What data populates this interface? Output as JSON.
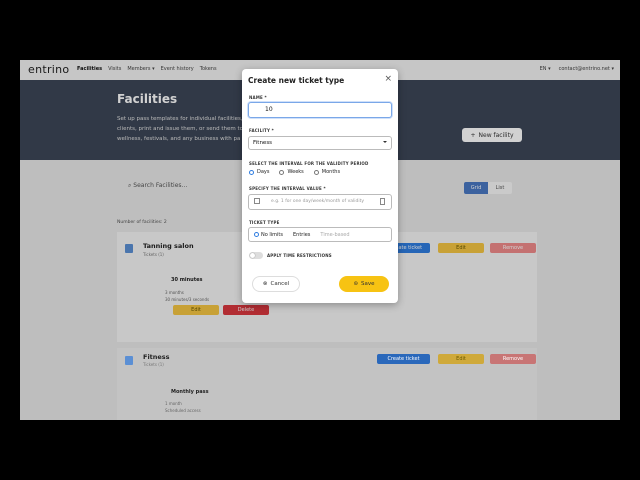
{
  "nav": {
    "logo": "entrino",
    "items": [
      "Facilities",
      "Visits",
      "Members ▾",
      "Event history",
      "Tokens"
    ],
    "lang": "EN ▾",
    "account": "contact@entrino.net ▾"
  },
  "hero": {
    "title": "Facilities",
    "description": "Set up pass templates for individual facilities, add clients, print and issue them, or send them to wellness, festivals, and any business with pa",
    "new_facility": "New facility"
  },
  "toolbar": {
    "search_placeholder": "Search Facilities...",
    "grid_label": "Grid",
    "list_label": "List"
  },
  "number_of_facilities": "Number of facilities: 2",
  "facilities": [
    {
      "name": "Tanning salon",
      "tickets_count": "Tickets (1)",
      "create_ticket": "Create ticket",
      "edit": "Edit",
      "remove": "Remove",
      "ticket": {
        "name": "30 minutes",
        "meta1": "3 months",
        "meta2": "30 minutes/3 seconds",
        "edit": "Edit",
        "delete": "Delete"
      }
    },
    {
      "name": "Fitness",
      "tickets_count": "Tickets (1)",
      "create_ticket": "Create ticket",
      "edit": "Edit",
      "remove": "Remove",
      "ticket": {
        "name": "Monthly pass",
        "meta1": "1 month",
        "meta2": "Scheduled access"
      }
    }
  ],
  "modal": {
    "title": "Create new ticket type",
    "close": "×",
    "name_label": "NAME *",
    "name_value": "10",
    "facility_label": "FACILITY *",
    "facility_value": "Fitness",
    "interval_label": "SELECT THE INTERVAL FOR THE VALIDITY PERIOD",
    "interval_options": [
      "Days",
      "Weeks",
      "Months"
    ],
    "interval_value_label": "SPECIFY THE INTERVAL VALUE *",
    "interval_value_placeholder": "e.g. 1 for one day/week/month of validity",
    "ticket_type_label": "TICKET TYPE",
    "ticket_type_options": [
      "No limits",
      "Entries",
      "Time-based"
    ],
    "time_restrictions_label": "APPLY TIME RESTRICTIONS",
    "cancel": "Cancel",
    "save": "Save"
  },
  "colors": {
    "accent": "#2f7de0",
    "save": "#f7c313",
    "hero": "#3c4657"
  }
}
